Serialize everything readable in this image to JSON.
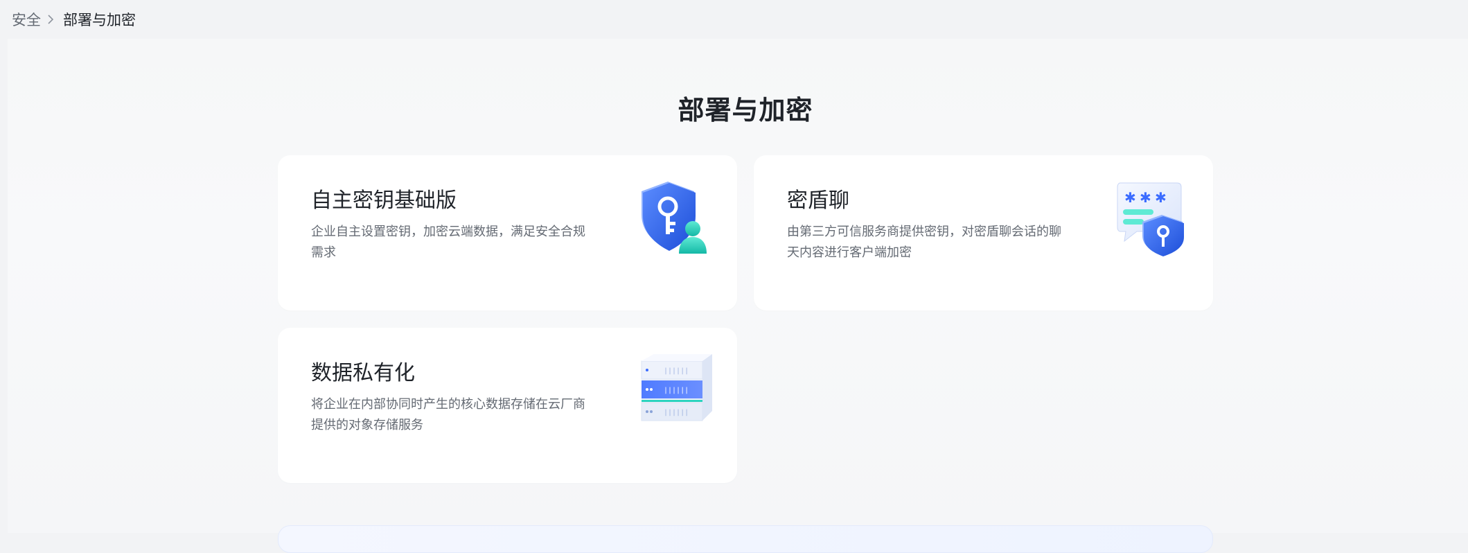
{
  "breadcrumb": {
    "parent": "安全",
    "current": "部署与加密"
  },
  "page": {
    "title": "部署与加密"
  },
  "cards": [
    {
      "title": "自主密钥基础版",
      "description": "企业自主设置密钥，加密云端数据，满足安全合规需求",
      "icon": "shield-key-user-icon"
    },
    {
      "title": "密盾聊",
      "description": "由第三方可信服务商提供密钥，对密盾聊会话的聊天内容进行客户端加密",
      "icon": "chat-bubble-shield-icon"
    },
    {
      "title": "数据私有化",
      "description": "将企业在内部协同时产生的核心数据存储在云厂商提供的对象存储服务",
      "icon": "server-stack-icon"
    }
  ],
  "colors": {
    "accent_blue": "#3370ff",
    "accent_teal": "#2dd4bf",
    "text_primary": "#1f2329",
    "text_secondary": "#646a73"
  }
}
